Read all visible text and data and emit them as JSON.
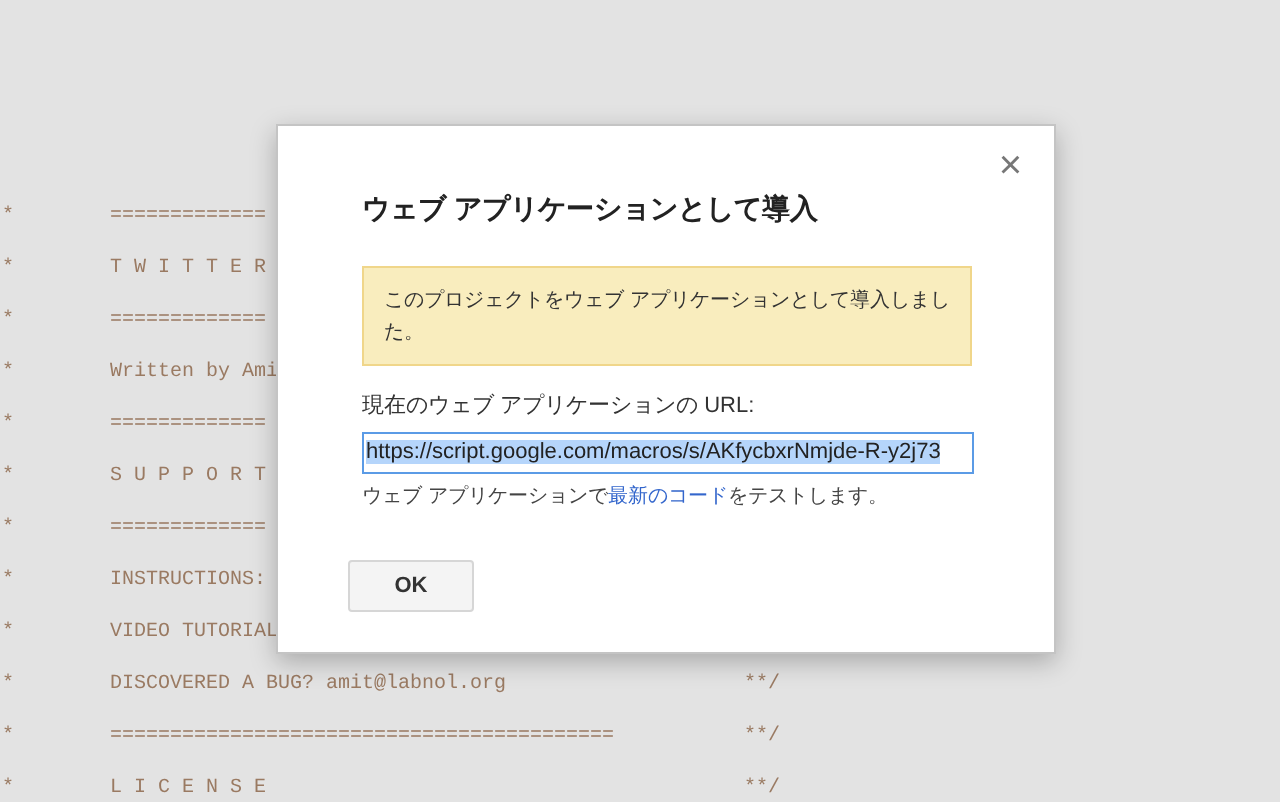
{
  "code_listing": {
    "lines": [
      {
        "prefix": "*",
        "text": "============="
      },
      {
        "prefix": "*",
        "text": "T W I T T E R"
      },
      {
        "prefix": "*",
        "text": "============="
      },
      {
        "prefix": "*",
        "text": "Written by Ami"
      },
      {
        "prefix": "*",
        "text": "============="
      },
      {
        "prefix": "*",
        "text": "S U P P O R T"
      },
      {
        "prefix": "*",
        "text": "============="
      },
      {
        "prefix": "*",
        "text": "INSTRUCTIONS:"
      },
      {
        "prefix": "*",
        "text": "VIDEO TUTORIAL"
      },
      {
        "prefix": "*",
        "text": "DISCOVERED A BUG? amit@labnol.org",
        "suffix": "**/"
      },
      {
        "prefix": "*",
        "text": "==========================================",
        "suffix": "**/"
      },
      {
        "prefix": "*",
        "text": "L I C E N S E",
        "suffix": "**/"
      }
    ]
  },
  "dialog": {
    "close": "×",
    "title": "ウェブ アプリケーションとして導入",
    "notice": "このプロジェクトをウェブ アプリケーションとして導入しました。",
    "url_label": "現在のウェブ アプリケーションの URL:",
    "url_field": {
      "value": "https://script.google.com/macros/s/AKfycbxrNmjde-R-y2j73",
      "selected": true
    },
    "hint": {
      "before": "ウェブ アプリケーションで",
      "link": "最新のコード",
      "after": "をテストします。"
    },
    "buttons": [
      "OK"
    ]
  }
}
